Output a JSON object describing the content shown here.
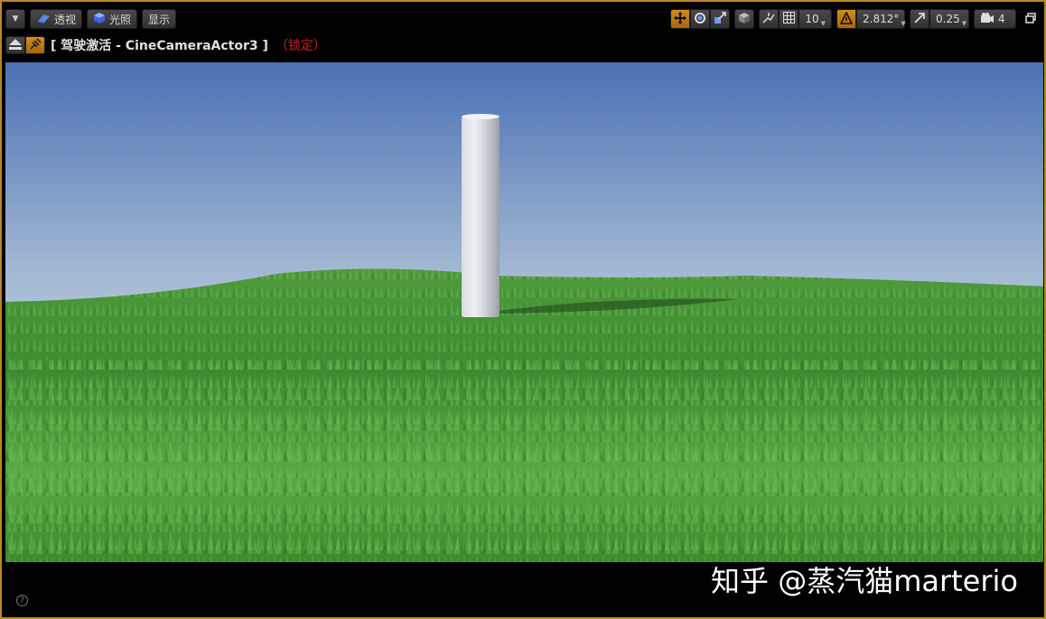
{
  "toolbar": {
    "perspective_label": "透视",
    "lit_label": "光照",
    "show_label": "显示",
    "grid_snap_value": "10",
    "rotation_snap_value": "2.812°",
    "scale_snap_value": "0.25",
    "camera_speed_value": "4"
  },
  "pilot": {
    "text": "[ 驾驶激活 - CineCameraActor3 ]",
    "locked_text": "（锁定）"
  },
  "watermark": "知乎 @蒸汽猫marterio",
  "colors": {
    "border": "#b58a1e",
    "accent": "#d38b1c",
    "locked": "#d02020"
  }
}
